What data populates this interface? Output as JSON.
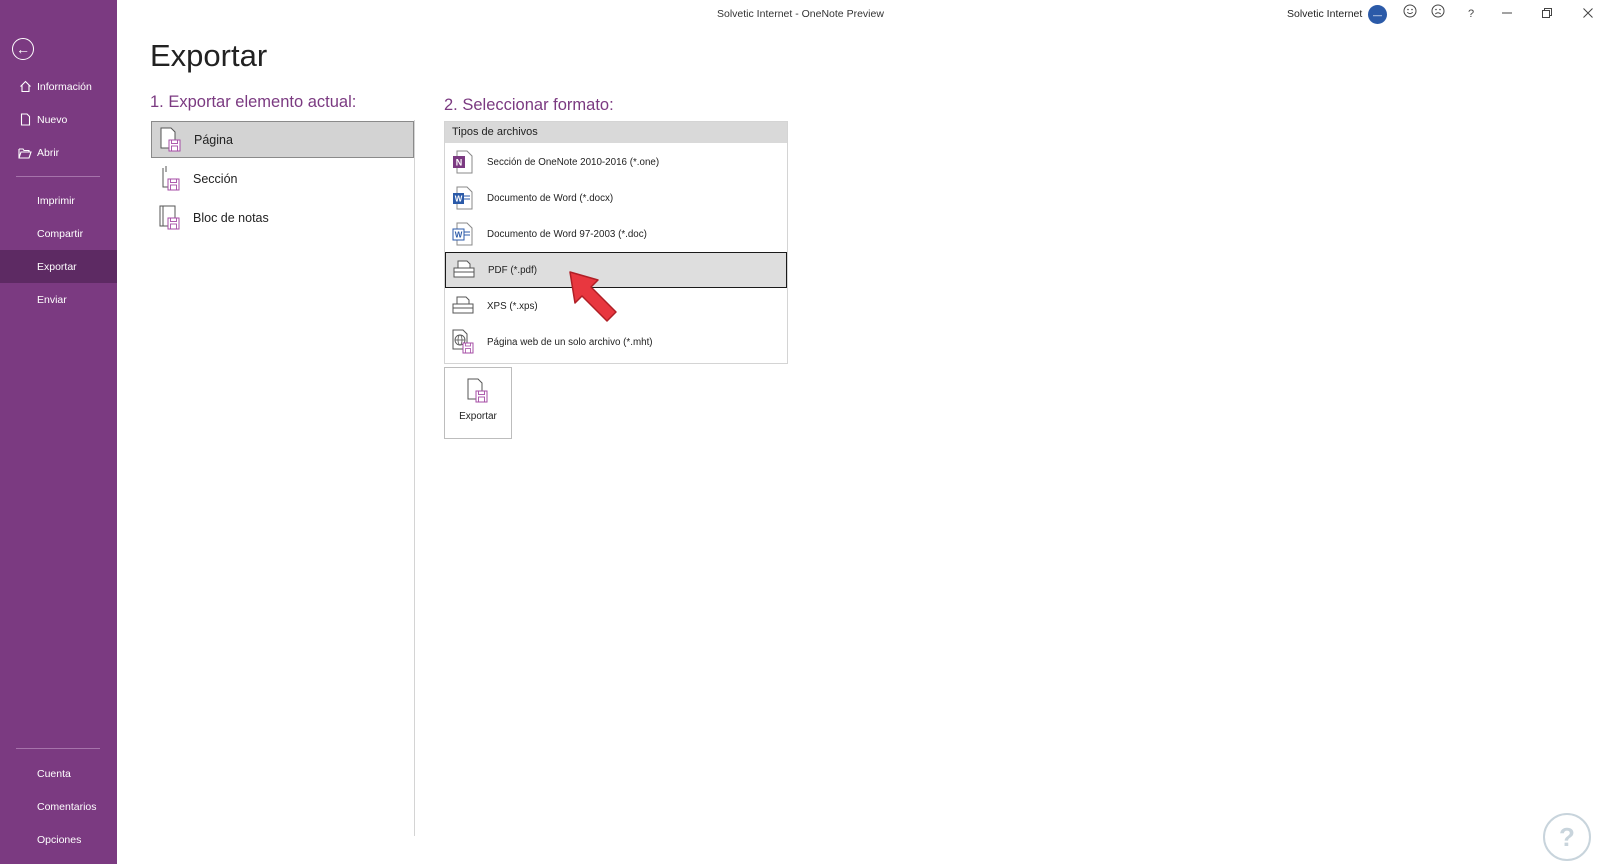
{
  "window": {
    "title": "Solvetic Internet  -  OneNote Preview",
    "account_name": "Solvetic Internet",
    "avatar_initials": "—",
    "help_label": "?"
  },
  "sidebar": {
    "items": [
      {
        "label": "Información",
        "icon": "home-icon"
      },
      {
        "label": "Nuevo",
        "icon": "new-document-icon"
      },
      {
        "label": "Abrir",
        "icon": "open-folder-icon"
      },
      {
        "label": "Imprimir"
      },
      {
        "label": "Compartir"
      },
      {
        "label": "Exportar",
        "active": true
      },
      {
        "label": "Enviar"
      },
      {
        "label": "Cuenta"
      },
      {
        "label": "Comentarios"
      },
      {
        "label": "Opciones"
      }
    ]
  },
  "main": {
    "title": "Exportar",
    "step1_heading": "1. Exportar elemento actual:",
    "step2_heading": "2. Seleccionar formato:",
    "export_items": [
      {
        "label": "Página",
        "selected": true
      },
      {
        "label": "Sección"
      },
      {
        "label": "Bloc de notas"
      }
    ],
    "file_types_header": "Tipos de archivos",
    "file_types": [
      {
        "label": "Sección de OneNote 2010-2016 (*.one)",
        "icon": "onenote-icon"
      },
      {
        "label": "Documento de Word (*.docx)",
        "icon": "word-icon"
      },
      {
        "label": "Documento de Word 97-2003 (*.doc)",
        "icon": "word-97-icon"
      },
      {
        "label": "PDF (*.pdf)",
        "icon": "pdf-printer-icon",
        "selected": true
      },
      {
        "label": "XPS (*.xps)",
        "icon": "xps-printer-icon"
      },
      {
        "label": "Página web de un solo archivo (*.mht)",
        "icon": "web-page-icon"
      }
    ],
    "export_button_label": "Exportar"
  },
  "colors": {
    "sidebar": "#7b3a81",
    "sidebar_active": "#5d2a63",
    "heading": "#7b3a81",
    "selection": "#d3d3d3",
    "annotation_arrow": "#e8373f"
  }
}
